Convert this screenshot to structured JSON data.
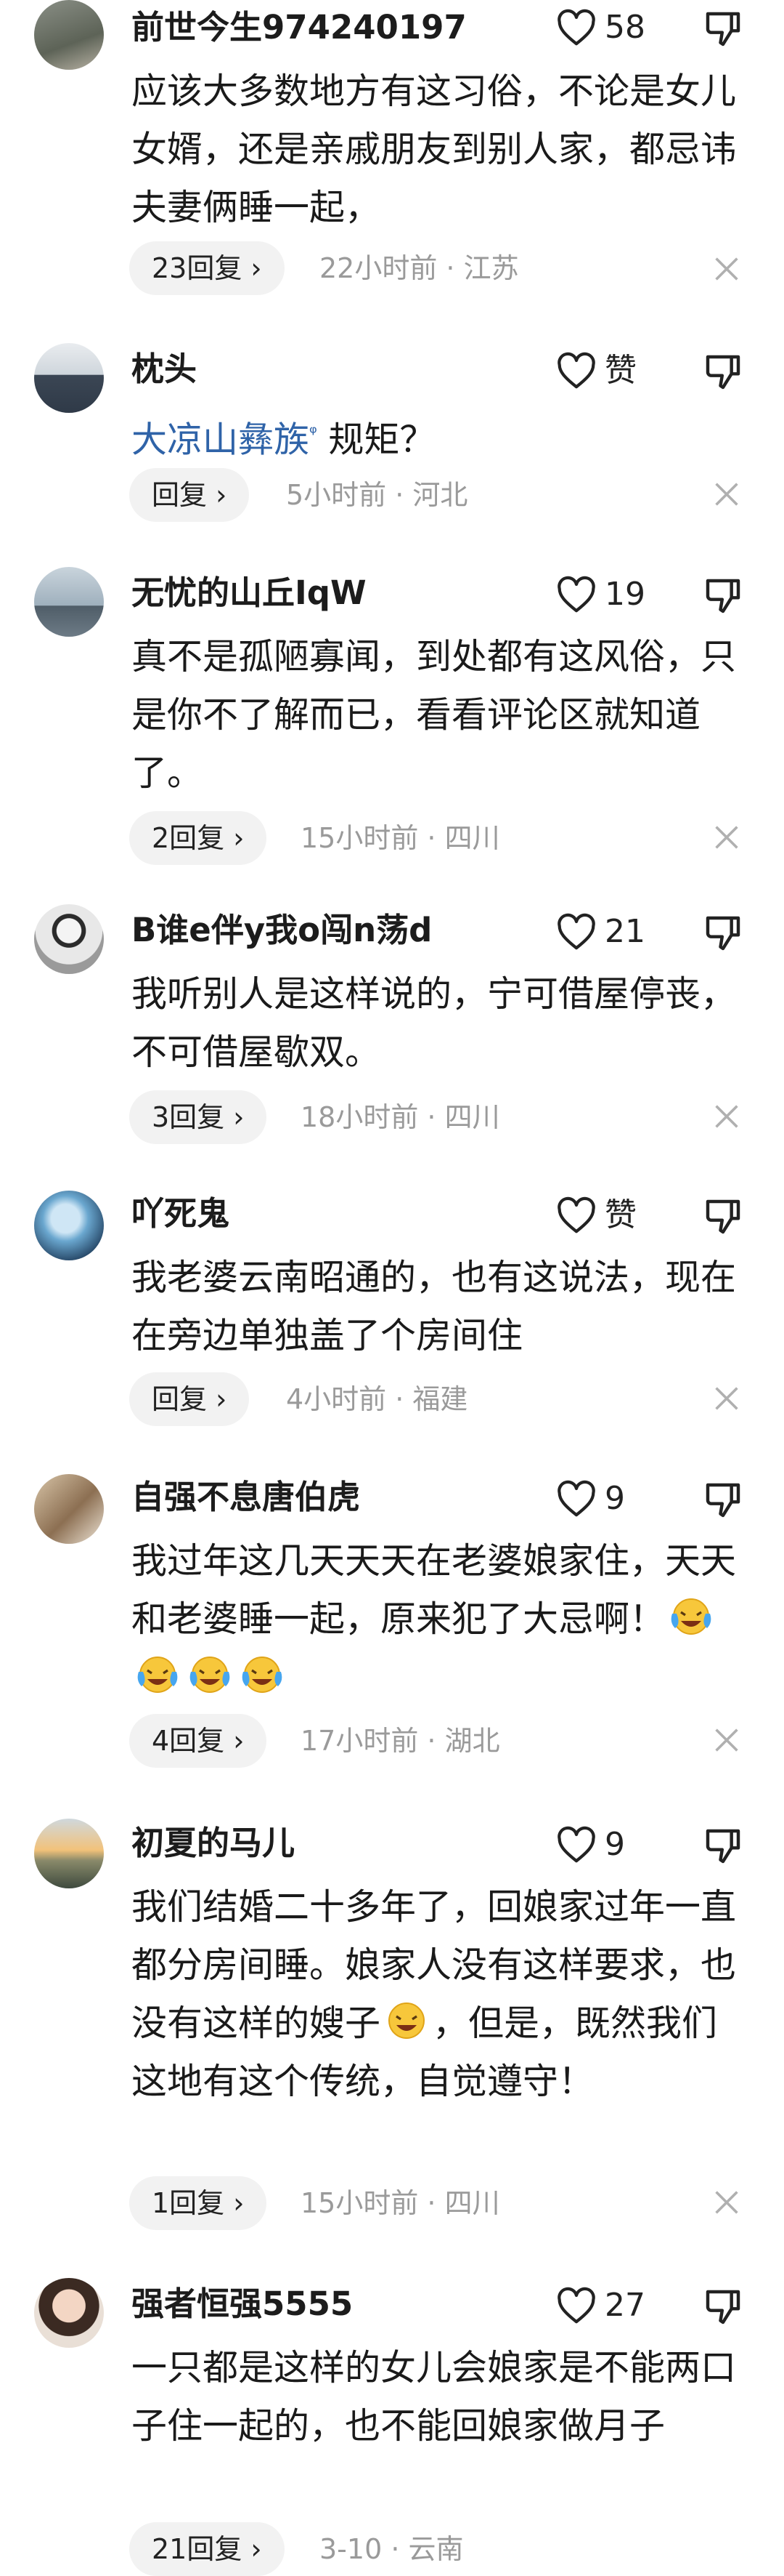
{
  "icons": {
    "like": "heart-outline-icon",
    "dislike": "thumbs-down-icon",
    "close": "close-x-icon",
    "chevron": "chevron-right-icon",
    "emoji": "laughing-crying-emoji"
  },
  "comments": [
    {
      "username": "前世今生974240197",
      "likes": "58",
      "text": "应该大多数地方有这习俗，不论是女儿女婿，还是亲戚朋友到别人家，都忌讳夫妻俩睡一起，",
      "reply_label": "23回复 ›",
      "meta": "22小时前 · 江苏"
    },
    {
      "username": "枕头",
      "likes": "赞",
      "link_text": "大凉山彝族",
      "text": " 规矩？",
      "reply_label": "回复 ›",
      "meta": "5小时前 · 河北"
    },
    {
      "username": "无忧的山丘IqW",
      "likes": "19",
      "text": "真不是孤陋寡闻，到处都有这风俗，只是你不了解而已，看看评论区就知道了。",
      "reply_label": "2回复 ›",
      "meta": "15小时前 · 四川"
    },
    {
      "username": "B谁e伴y我o闯n荡d",
      "likes": "21",
      "text": "我听别人是这样说的，宁可借屋停丧，不可借屋歇双。",
      "reply_label": "3回复 ›",
      "meta": "18小时前 · 四川"
    },
    {
      "username": "吖死鬼",
      "likes": "赞",
      "text": "我老婆云南昭通的，也有这说法，现在在旁边单独盖了个房间住",
      "reply_label": "回复 ›",
      "meta": "4小时前 · 福建"
    },
    {
      "username": "自强不息唐伯虎",
      "likes": "9",
      "text": "我过年这几天天天在老婆娘家住，天天和老婆睡一起，原来犯了大忌啊！",
      "reply_label": "4回复 ›",
      "meta": "17小时前 · 湖北"
    },
    {
      "username": "初夏的马儿",
      "likes": "9",
      "text": "我们结婚二十多年了，回娘家过年一直都分房间睡。娘家人没有这样要求，也没有这样的嫂子",
      "text_after": "，但是，既然我们这地有这个传统，自觉遵守！",
      "reply_label": "1回复 ›",
      "meta": "15小时前 · 四川"
    },
    {
      "username": "强者恒强5555",
      "likes": "27",
      "text": "一只都是这样的女儿会娘家是不能两口子住一起的，也不能回娘家做月子",
      "reply_label": "21回复 ›",
      "meta": "3-10 · 云南"
    }
  ]
}
